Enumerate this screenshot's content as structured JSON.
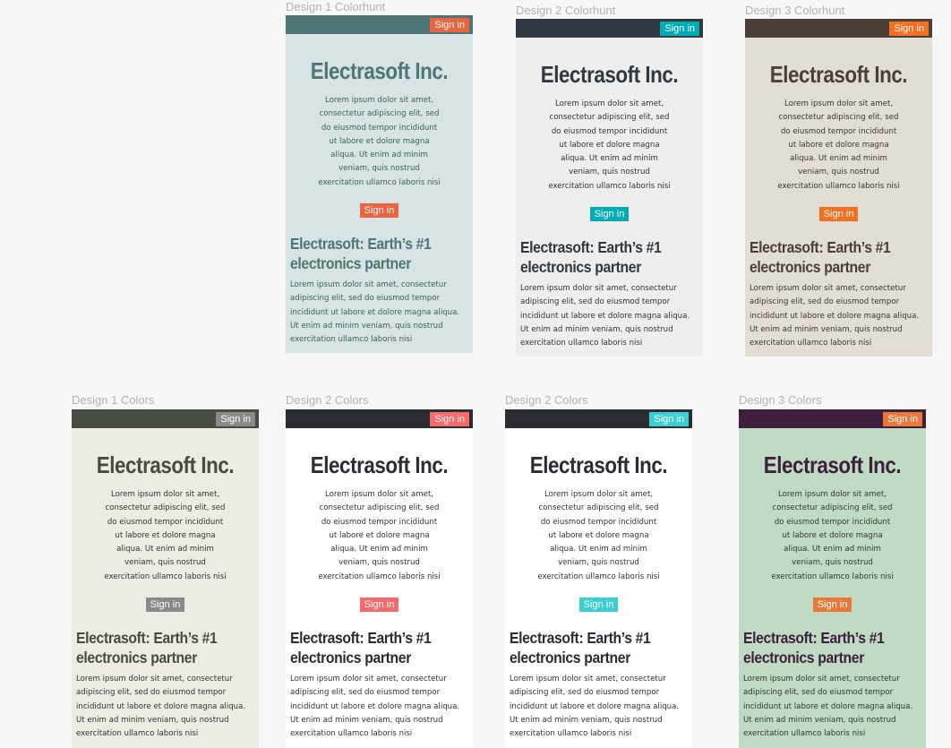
{
  "frames": [
    {
      "label": "Design 1 Colorhunt",
      "nav_signin": "Sign in",
      "brand": "Electrasoft Inc.",
      "hero_text": "Lorem ipsum dolor sit amet, consectetur adipiscing elit, sed do eiusmod tempor incididunt ut labore et dolore magna aliqua. Ut enim ad minim veniam, quis nostrud exercitation ullamco laboris nisi",
      "hero_signin": "Sign in",
      "headline": "Electrasoft: Earth’s #1 electronics partner",
      "body_text": "Lorem ipsum dolor sit amet, consectetur adipiscing elit, sed do eiusmod tempor incididunt ut labore et dolore magna aliqua. Ut enim ad minim veniam, quis nostrud exercitation ullamco laboris nisi",
      "colors": {
        "bar": "#4d7675",
        "bg": "#d6e4e5",
        "brand": "#4d7675",
        "signin": "#eb6440",
        "hero_btn": "#eb6440",
        "headline": "#4d7675",
        "text": "#3e5f5e"
      }
    },
    {
      "label": "Design 2 Colorhunt",
      "nav_signin": "Sign in",
      "brand": "Electrasoft Inc.",
      "hero_text": "Lorem ipsum dolor sit amet, consectetur adipiscing elit, sed do eiusmod tempor incididunt ut labore et dolore magna aliqua. Ut enim ad minim veniam, quis nostrud exercitation ullamco laboris nisi",
      "hero_signin": "Sign in",
      "headline": "Electrasoft: Earth’s #1 electronics partner",
      "body_text": "Lorem ipsum dolor sit amet, consectetur adipiscing elit, sed do eiusmod tempor incididunt ut labore et dolore magna aliqua. Ut enim ad minim veniam, quis nostrud exercitation ullamco laboris nisi",
      "colors": {
        "bar": "#303841",
        "bg": "#eeeeee",
        "brand": "#303841",
        "signin": "#00adb5",
        "hero_btn": "#00adb5",
        "headline": "#303841",
        "text": "#333333"
      }
    },
    {
      "label": "Design 3 Colorhunt",
      "nav_signin": "Sign in",
      "brand": "Electrasoft Inc.",
      "hero_text": "Lorem ipsum dolor sit amet, consectetur adipiscing elit, sed do eiusmod tempor incididunt ut labore et dolore magna aliqua. Ut enim ad minim veniam, quis nostrud exercitation ullamco laboris nisi",
      "hero_signin": "Sign in",
      "headline": "Electrasoft: Earth’s #1 electronics partner",
      "body_text": "Lorem ipsum dolor sit amet, consectetur adipiscing elit, sed do eiusmod tempor incididunt ut labore et dolore magna aliqua. Ut enim ad minim veniam, quis nostrud exercitation ullamco laboris nisi",
      "colors": {
        "bar": "#4b4038",
        "bg": "#e3ded3",
        "brand": "#4b4038",
        "signin": "#f2701f",
        "hero_btn": "#f2701f",
        "headline": "#4b4038",
        "text": "#3d342d"
      }
    },
    {
      "label": "Design 1 Colors",
      "nav_signin": "Sign in",
      "brand": "Electrasoft Inc.",
      "hero_text": "Lorem ipsum dolor sit amet, consectetur adipiscing elit, sed do eiusmod tempor incididunt ut labore et dolore magna aliqua. Ut enim ad minim veniam, quis nostrud exercitation ullamco laboris nisi",
      "hero_signin": "Sign in",
      "headline": "Electrasoft: Earth’s #1 electronics partner",
      "body_text": "Lorem ipsum dolor sit amet, consectetur adipiscing elit, sed do eiusmod tempor incididunt ut labore et dolore magna aliqua. Ut enim ad minim veniam, quis nostrud exercitation ullamco laboris nisi",
      "colors": {
        "bar": "#474c42",
        "bg": "#ecebe4",
        "brand": "#474c42",
        "signin": "#8a8a8a",
        "hero_btn": "#8a8a8a",
        "headline": "#474c42",
        "text": "#333333"
      }
    },
    {
      "label": "Design 2 Colors",
      "nav_signin": "Sign in",
      "brand": "Electrasoft Inc.",
      "hero_text": "Lorem ipsum dolor sit amet, consectetur adipiscing elit, sed do eiusmod tempor incididunt ut labore et dolore magna aliqua. Ut enim ad minim veniam, quis nostrud exercitation ullamco laboris nisi",
      "hero_signin": "Sign in",
      "headline": "Electrasoft: Earth’s #1 electronics partner",
      "body_text": "Lorem ipsum dolor sit amet, consectetur adipiscing elit, sed do eiusmod tempor incididunt ut labore et dolore magna aliqua. Ut enim ad minim veniam, quis nostrud exercitation ullamco laboris nisi",
      "colors": {
        "bar": "#2b2d33",
        "bg": "#ffffff",
        "brand": "#2b2d33",
        "signin": "#f56a6a",
        "hero_btn": "#f56a6a",
        "headline": "#2b2d33",
        "text": "#333333"
      }
    },
    {
      "label": "Design 2 Colors",
      "nav_signin": "Sign in",
      "brand": "Electrasoft Inc.",
      "hero_text": "Lorem ipsum dolor sit amet, consectetur adipiscing elit, sed do eiusmod tempor incididunt ut labore et dolore magna aliqua. Ut enim ad minim veniam, quis nostrud exercitation ullamco laboris nisi",
      "hero_signin": "Sign in",
      "headline": "Electrasoft: Earth’s #1 electronics partner",
      "body_text": "Lorem ipsum dolor sit amet, consectetur adipiscing elit, sed do eiusmod tempor incididunt ut labore et dolore magna aliqua. Ut enim ad minim veniam, quis nostrud exercitation ullamco laboris nisi",
      "colors": {
        "bar": "#2b2d33",
        "bg": "#ffffff",
        "brand": "#2b2d33",
        "signin": "#3ccfcf",
        "hero_btn": "#3ccfcf",
        "headline": "#2b2d33",
        "text": "#333333"
      }
    },
    {
      "label": "Design 3 Colors",
      "nav_signin": "Sign in",
      "brand": "Electrasoft Inc.",
      "hero_text": "Lorem ipsum dolor sit amet, consectetur adipiscing elit, sed do eiusmod tempor incididunt ut labore et dolore magna aliqua. Ut enim ad minim veniam, quis nostrud exercitation ullamco laboris nisi",
      "hero_signin": "Sign in",
      "headline": "Electrasoft: Earth’s #1 electronics partner",
      "body_text": "Lorem ipsum dolor sit amet, consectetur adipiscing elit, sed do eiusmod tempor incididunt ut labore et dolore magna aliqua. Ut enim ad minim veniam, quis nostrud exercitation ullamco laboris nisi",
      "colors": {
        "bar": "#3d1f3d",
        "bg": "#bfdcc2",
        "brand": "#3d1f3d",
        "signin": "#e8793b",
        "hero_btn": "#e8793b",
        "headline": "#3d1f3d",
        "text": "#333333"
      }
    }
  ]
}
